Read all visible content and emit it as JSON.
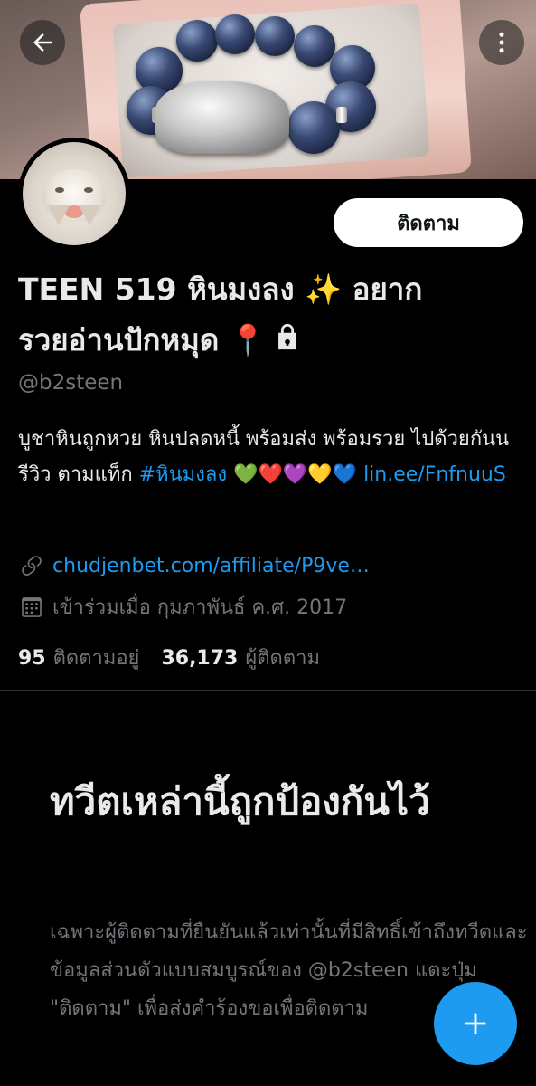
{
  "profile": {
    "display_name_line1": "TEEN 519 หินมงลง ✨ อยาก",
    "display_name_line2": "รวยอ่านปักหมุด 📍",
    "handle": "@b2steen",
    "follow_button_label": "ติดตาม",
    "bio_text": "บูชาหินถูกหวย หินปลดหนี้ พร้อมส่ง พร้อมรวย ไปด้วยกันน รีวิว ตามแท็ก ",
    "bio_hashtag": "#หินมงลง",
    "bio_emojis": " 💚❤️💜💛💙 ",
    "bio_link": "lin.ee/FnfnuuS",
    "website": "chudjenbet.com/affiliate/P9ve…",
    "joined": "เข้าร่วมเมื่อ กุมภาพันธ์ ค.ศ. 2017",
    "following_count": "95",
    "following_label": "ติดตามอยู่",
    "followers_count": "36,173",
    "followers_label": "ผู้ติดตาม"
  },
  "protected": {
    "title": "ทวีตเหล่านี้ถูกป้องกันไว้",
    "body": "เฉพาะผู้ติดตามที่ยืนยันแล้วเท่านั้นที่มีสิทธิ์เข้าถึงทวีตและข้อมูลส่วนตัวแบบสมบูรณ์ของ @b2steen แตะปุ่ม \"ติดตาม\" เพื่อส่งคำร้องขอเพื่อติดตาม"
  },
  "icons": {
    "back": "arrow-left-icon",
    "more": "more-vertical-icon",
    "lock": "lock-icon",
    "link": "link-icon",
    "calendar": "calendar-icon",
    "compose": "plus-icon"
  },
  "colors": {
    "background": "#000000",
    "accent": "#1d9bf0",
    "text_primary": "#e7e9ea",
    "text_secondary": "#71767b"
  }
}
